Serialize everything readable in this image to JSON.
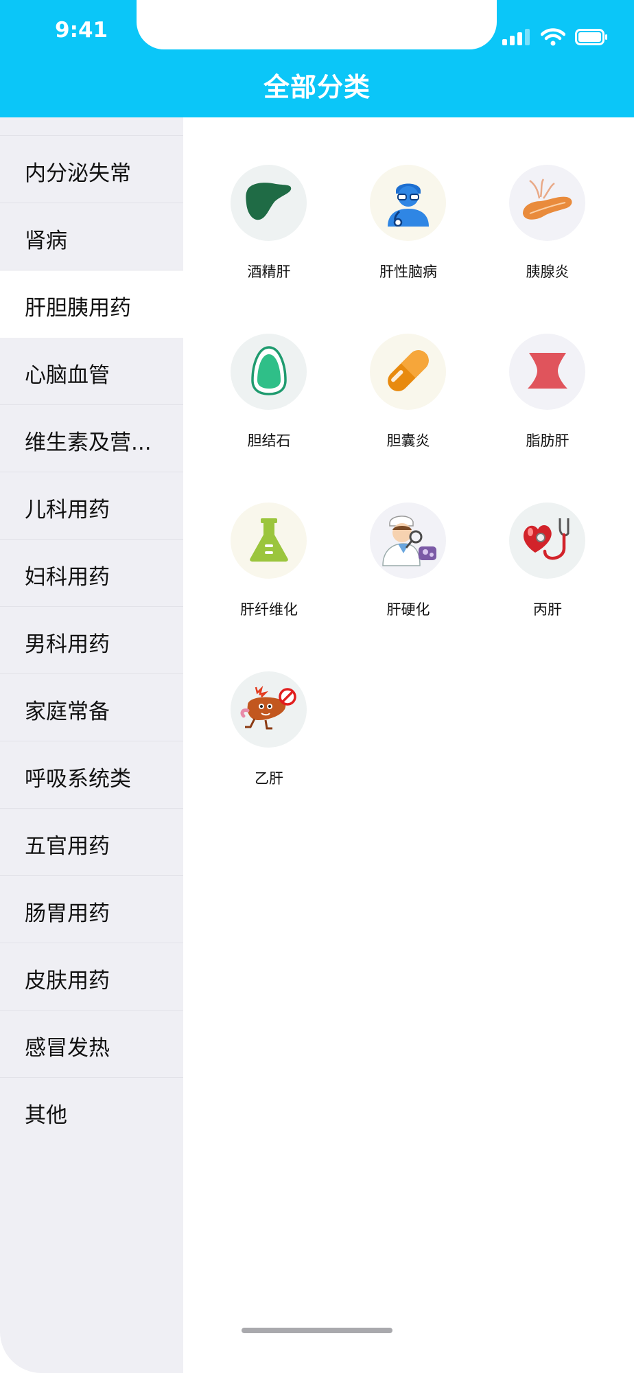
{
  "status_bar": {
    "time": "9:41"
  },
  "header": {
    "title": "全部分类",
    "background": "#0bc6f8"
  },
  "sidebar": {
    "active_index": 2,
    "items": [
      {
        "label": "内分泌失常"
      },
      {
        "label": "肾病"
      },
      {
        "label": "肝胆胰用药"
      },
      {
        "label": "心脑血管"
      },
      {
        "label": "维生素及营..."
      },
      {
        "label": "儿科用药"
      },
      {
        "label": "妇科用药"
      },
      {
        "label": "男科用药"
      },
      {
        "label": "家庭常备"
      },
      {
        "label": "呼吸系统类"
      },
      {
        "label": "五官用药"
      },
      {
        "label": "肠胃用药"
      },
      {
        "label": "皮肤用药"
      },
      {
        "label": "感冒发热"
      },
      {
        "label": "其他"
      }
    ]
  },
  "categories": [
    {
      "label": "酒精肝",
      "icon": "liver-icon"
    },
    {
      "label": "肝性脑病",
      "icon": "doctor-icon"
    },
    {
      "label": "胰腺炎",
      "icon": "pancreas-icon"
    },
    {
      "label": "胆结石",
      "icon": "gallstone-icon"
    },
    {
      "label": "胆囊炎",
      "icon": "capsule-icon"
    },
    {
      "label": "脂肪肝",
      "icon": "waist-icon"
    },
    {
      "label": "肝纤维化",
      "icon": "flask-icon"
    },
    {
      "label": "肝硬化",
      "icon": "doctor-microscope-icon"
    },
    {
      "label": "丙肝",
      "icon": "heart-stethoscope-icon"
    },
    {
      "label": "乙肝",
      "icon": "liver-character-icon"
    }
  ]
}
